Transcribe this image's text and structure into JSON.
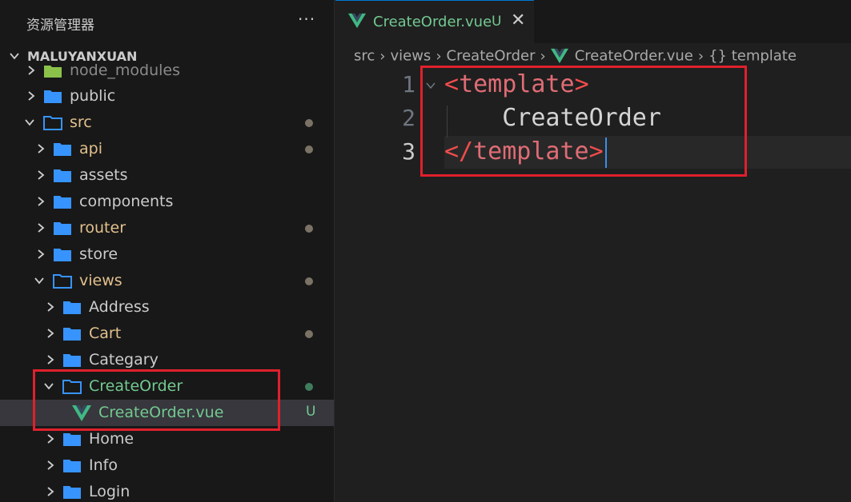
{
  "sidebar": {
    "title": "资源管理器",
    "more_label": "···",
    "root_label": "MALUYANXUAN",
    "items": [
      {
        "label": "node_modules",
        "level": 1,
        "expanded": false,
        "status": ""
      },
      {
        "label": "public",
        "level": 1,
        "expanded": false,
        "status": ""
      },
      {
        "label": "src",
        "level": 1,
        "expanded": true,
        "status": "dot"
      },
      {
        "label": "api",
        "level": 2,
        "expanded": false,
        "status": "dot"
      },
      {
        "label": "assets",
        "level": 2,
        "expanded": false,
        "status": ""
      },
      {
        "label": "components",
        "level": 2,
        "expanded": false,
        "status": ""
      },
      {
        "label": "router",
        "level": 2,
        "expanded": false,
        "status": "dot"
      },
      {
        "label": "store",
        "level": 2,
        "expanded": false,
        "status": ""
      },
      {
        "label": "views",
        "level": 2,
        "expanded": true,
        "status": "dot"
      },
      {
        "label": "Address",
        "level": 3,
        "expanded": false,
        "status": ""
      },
      {
        "label": "Cart",
        "level": 3,
        "expanded": false,
        "status": "dot"
      },
      {
        "label": "Categary",
        "level": 3,
        "expanded": false,
        "status": ""
      },
      {
        "label": "CreateOrder",
        "level": 3,
        "expanded": true,
        "status": "dot-green"
      },
      {
        "label": "CreateOrder.vue",
        "level": 4,
        "expanded": false,
        "status": "U"
      },
      {
        "label": "Home",
        "level": 3,
        "expanded": false,
        "status": ""
      },
      {
        "label": "Info",
        "level": 3,
        "expanded": false,
        "status": ""
      },
      {
        "label": "Login",
        "level": 3,
        "expanded": false,
        "status": ""
      }
    ]
  },
  "tab": {
    "filename": "CreateOrder.vue",
    "status": "U",
    "close": "✕"
  },
  "breadcrumb": {
    "parts": [
      "src",
      "views",
      "CreateOrder",
      "CreateOrder.vue",
      "{} template"
    ],
    "separator": "›"
  },
  "editor": {
    "lines": [
      {
        "num": "1",
        "open": "<",
        "tag": "template",
        "close": ">",
        "text": ""
      },
      {
        "num": "2",
        "open": "",
        "tag": "",
        "close": "",
        "text": "    CreateOrder"
      },
      {
        "num": "3",
        "open": "</",
        "tag": "template",
        "close": ">",
        "text": ""
      }
    ]
  },
  "colors": {
    "accent": "#0078d4",
    "untracked": "#73c991",
    "modified": "#e2c08d",
    "folder": "#3794ff",
    "highlight_box": "#e0202c",
    "vue_icon": "#41b883"
  }
}
